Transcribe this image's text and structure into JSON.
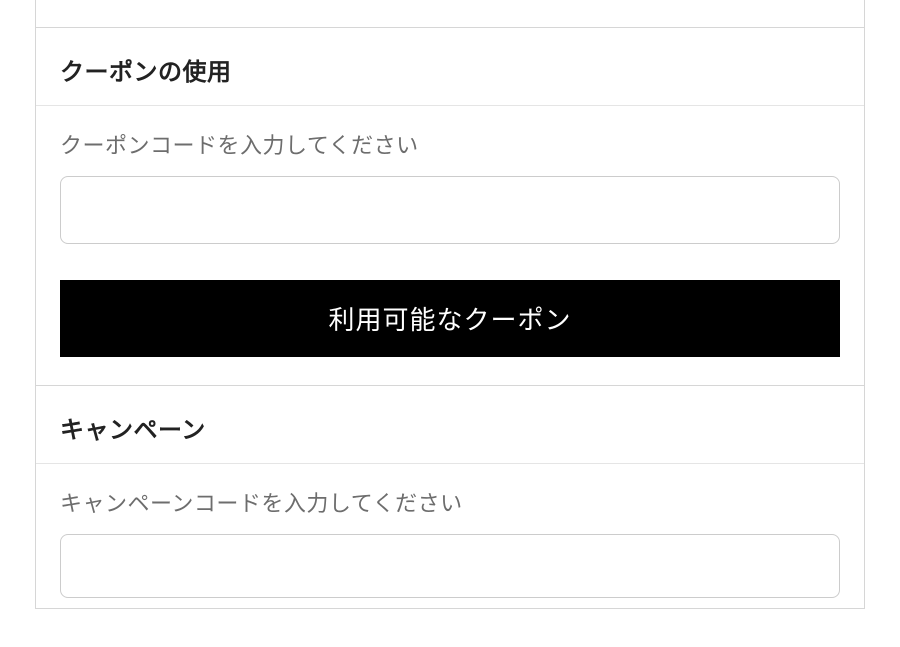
{
  "coupon": {
    "heading": "クーポンの使用",
    "input_label": "クーポンコードを入力してください",
    "input_value": "",
    "button_label": "利用可能なクーポン"
  },
  "campaign": {
    "heading": "キャンペーン",
    "input_label": "キャンペーンコードを入力してください",
    "input_value": ""
  }
}
